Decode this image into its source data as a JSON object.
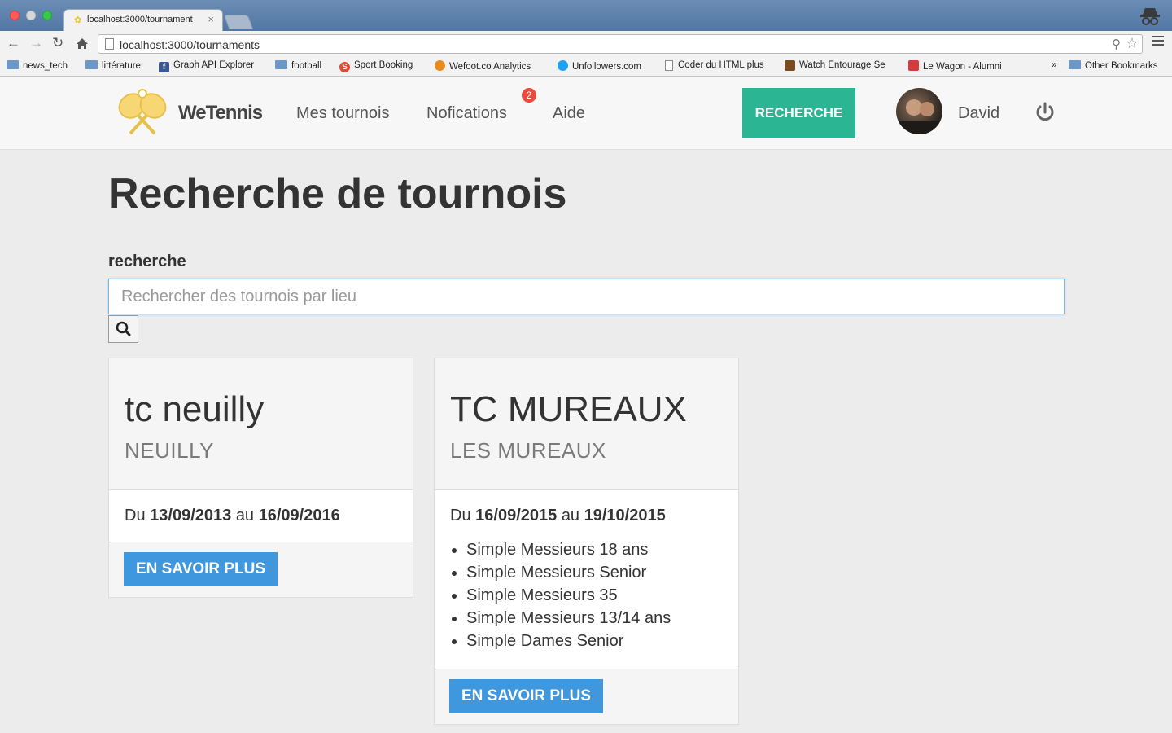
{
  "browser": {
    "tab_title": "localhost:3000/tournament",
    "tab_close": "×",
    "url": "localhost:3000/tournaments",
    "bookmarks": [
      "news_tech",
      "littérature",
      "Graph API Explorer",
      "football",
      "Sport Booking",
      "Wefoot.co Analytics",
      "Unfollowers.com",
      "Coder du HTML plus",
      "Watch Entourage Se",
      "Le Wagon - Alumni"
    ],
    "bookmarks_overflow": "»",
    "other_bookmarks": "Other Bookmarks"
  },
  "header": {
    "logo_text": "WeTennis",
    "nav": [
      "Mes tournois",
      "Nofications",
      "Aide"
    ],
    "notification_count": "2",
    "search_button": "RECHERCHE",
    "user_name": "David",
    "accent_color": "#2bb593",
    "badge_color": "#e84c3d"
  },
  "main": {
    "title": "Recherche de tournois",
    "search_label": "recherche",
    "search_placeholder": "Rechercher des tournois par lieu",
    "search_value": ""
  },
  "tournaments": [
    {
      "name": "tc neuilly",
      "city": "NEUILLY",
      "from_word": "Du",
      "start": "13/09/2013",
      "to_word": "au",
      "end": "16/09/2016",
      "categories": [],
      "button": "EN SAVOIR PLUS"
    },
    {
      "name": "TC MUREAUX",
      "city": "LES MUREAUX",
      "from_word": "Du",
      "start": "16/09/2015",
      "to_word": "au",
      "end": "19/10/2015",
      "categories": [
        "Simple Messieurs 18 ans",
        "Simple Messieurs Senior",
        "Simple Messieurs 35",
        "Simple Messieurs 13/14 ans",
        "Simple Dames Senior"
      ],
      "button": "EN SAVOIR PLUS"
    }
  ],
  "button_color": "#3f97de"
}
